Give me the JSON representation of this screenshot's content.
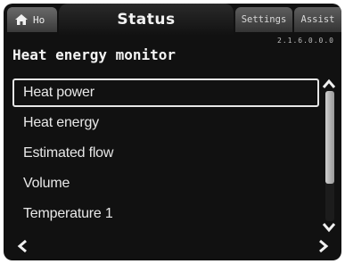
{
  "tabs": {
    "home_label": "Ho",
    "status_label": "Status",
    "settings_label": "Settings",
    "assist_label": "Assist"
  },
  "version": "2.1.6.0.0.0",
  "page_title": "Heat energy monitor",
  "list": {
    "items": [
      {
        "label": "Heat power",
        "selected": true
      },
      {
        "label": "Heat energy",
        "selected": false
      },
      {
        "label": "Estimated flow",
        "selected": false
      },
      {
        "label": "Volume",
        "selected": false
      },
      {
        "label": "Temperature 1",
        "selected": false
      }
    ]
  },
  "icons": {
    "home": "home-icon",
    "scroll_up": "chevron-up-icon",
    "scroll_down": "chevron-down-icon",
    "back": "chevron-left-icon",
    "forward": "chevron-right-icon"
  },
  "colors": {
    "background": "#111111",
    "text": "#e8e8e8",
    "selection_border": "#e6e6e6"
  }
}
